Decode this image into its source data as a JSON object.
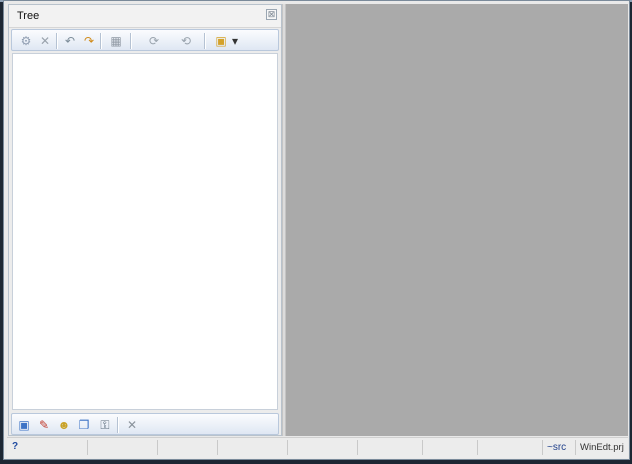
{
  "tree_panel": {
    "title": "Tree",
    "close_glyph": "⊠",
    "top_toolbar": [
      {
        "icon": "sitemap-icon",
        "glyph": "⚙",
        "color": "#8e9cb0"
      },
      {
        "icon": "delete-icon",
        "glyph": "✕",
        "color": "#9aa3ad"
      },
      {
        "icon": "undo-icon",
        "glyph": "↶",
        "color": "#7c8c99"
      },
      {
        "icon": "redo-icon",
        "glyph": "↷",
        "color": "#d08a18"
      },
      {
        "icon": "print-icon",
        "glyph": "▦",
        "color": "#8f98a3"
      },
      {
        "icon": "refresh-icon",
        "glyph": "⟳",
        "color": "#9aa4ae"
      },
      {
        "icon": "sync-icon",
        "glyph": "⟲",
        "color": "#9aa4ae"
      },
      {
        "icon": "project-icon",
        "glyph": "▣",
        "color": "#d4a22a"
      },
      {
        "icon": "dropdown-arrow-icon",
        "glyph": "▾",
        "color": "#333333"
      }
    ],
    "bottom_toolbar": [
      {
        "icon": "new-document-icon",
        "glyph": "▣",
        "color": "#3d73c6"
      },
      {
        "icon": "wand-icon",
        "glyph": "✎",
        "color": "#c0392b"
      },
      {
        "icon": "users-icon",
        "glyph": "☻",
        "color": "#c9a227"
      },
      {
        "icon": "copy-icon",
        "glyph": "❐",
        "color": "#3d73c6"
      },
      {
        "icon": "key-icon",
        "glyph": "⚿",
        "color": "#5a6b7a"
      },
      {
        "icon": "close-icon",
        "glyph": "✕",
        "color": "#8a939c"
      }
    ]
  },
  "statusbar": {
    "help": "?",
    "src": "~src",
    "project": "WinEdt.prj"
  }
}
